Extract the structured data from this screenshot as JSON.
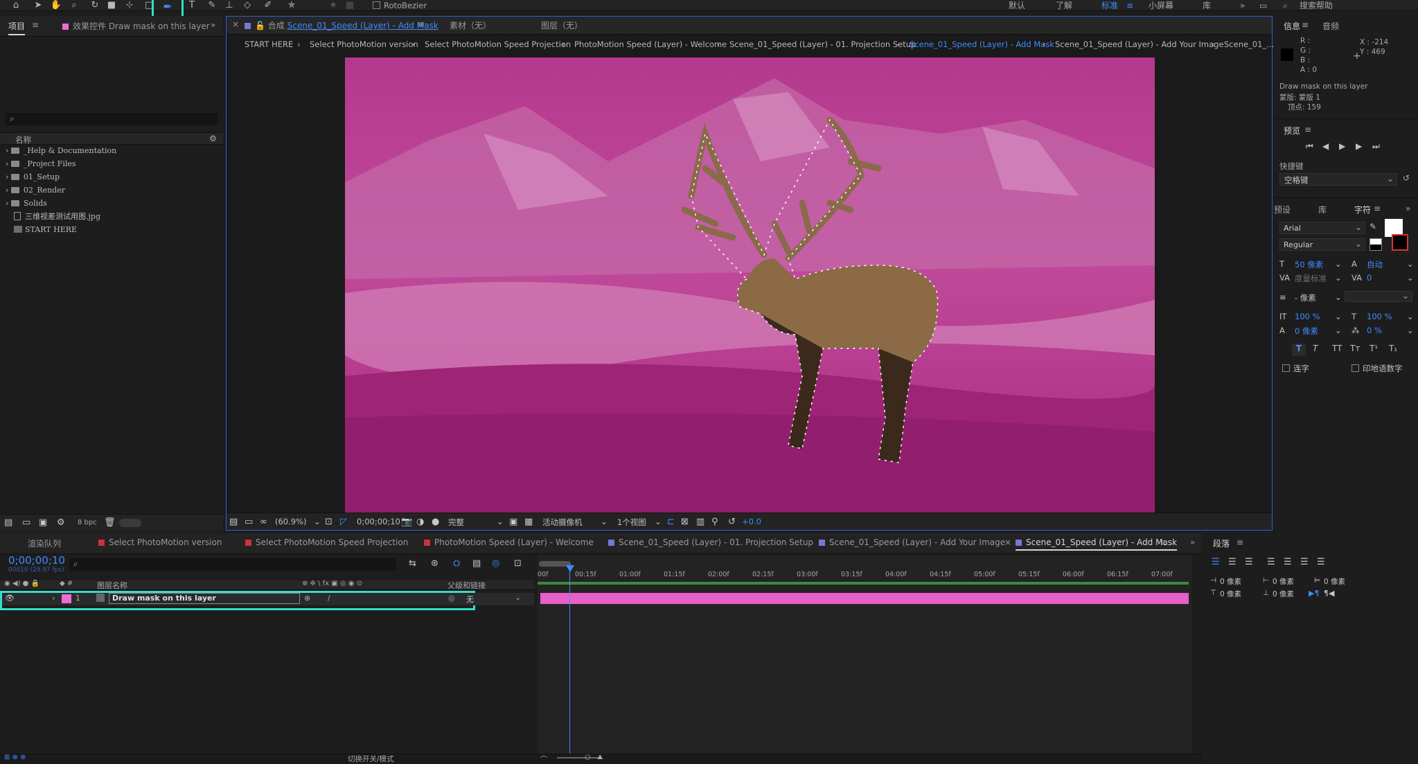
{
  "toolbar": {
    "rotobezier_label": "RotoBezier",
    "workspaces": [
      "默认",
      "了解",
      "标准",
      "小屏幕",
      "库"
    ],
    "search_placeholder": "搜索帮助"
  },
  "project_panel": {
    "tab_label": "项目",
    "effects_tab_label": "效果控件 Draw mask on this layer",
    "column_name": "名称",
    "items": [
      {
        "label": "_Help & Documentation",
        "type": "folder"
      },
      {
        "label": "_Project Files",
        "type": "folder"
      },
      {
        "label": "01_Setup",
        "type": "folder"
      },
      {
        "label": "02_Render",
        "type": "folder"
      },
      {
        "label": "Solids",
        "type": "folder"
      },
      {
        "label": "三维视差测试用图.jpg",
        "type": "file"
      },
      {
        "label": "START HERE",
        "type": "comp"
      }
    ],
    "bpc_label": "8 bpc"
  },
  "viewer": {
    "comp_tab_prefix": "合成",
    "comp_tab_name": "Scene_01_Speed (Layer) - Add Mask",
    "footage_tab": "素材（无）",
    "layer_tab": "图层（无）",
    "breadcrumbs": [
      "START HERE",
      "Select PhotoMotion version",
      "Select PhotoMotion Speed Projection",
      "PhotoMotion Speed (Layer) - Welcome",
      "Scene_01_Speed (Layer) - 01. Projection Setup",
      "Scene_01_Speed (Layer) - Add Mask",
      "Scene_01_Speed (Layer) - Add Your Image",
      "Scene_01_..."
    ],
    "active_breadcrumb": 5,
    "zoom": "(60.9%)",
    "timecode": "0;00;00;10",
    "resolution": "完整",
    "camera": "活动摄像机",
    "views": "1个视图",
    "exposure": "+0.0"
  },
  "info_panel": {
    "tab_info": "信息",
    "tab_audio": "音频",
    "r": "R :",
    "g": "G :",
    "b": "B :",
    "a": "A : 0",
    "x": "X : -214",
    "y": "Y : 469",
    "msg1": "Draw mask on this layer",
    "msg2": "蒙版: 蒙版 1",
    "msg3": "顶点: 159"
  },
  "preview_panel": {
    "title": "预览",
    "shortcut_label": "快捷键",
    "shortcut_value": "空格键"
  },
  "character_panel": {
    "tabs": [
      "预设",
      "库",
      "字符"
    ],
    "font": "Arial",
    "style": "Regular",
    "size": "50 像素",
    "leading": "自动",
    "kerning": "度量标准",
    "tracking": "0",
    "stroke": "- 像素",
    "vscale": "100 %",
    "hscale": "100 %",
    "baseline": "0 像素",
    "tsume": "0 %",
    "ligature": "连字",
    "hindi": "印地语数字",
    "fill_color": "#ffffff",
    "stroke_color": "#000000"
  },
  "timeline": {
    "render_queue": "渲染队列",
    "tabs": [
      {
        "label": "Select PhotoMotion version",
        "color": "#d0303a"
      },
      {
        "label": "Select PhotoMotion Speed Projection",
        "color": "#d0303a"
      },
      {
        "label": "PhotoMotion Speed (Layer) - Welcome",
        "color": "#d0303a"
      },
      {
        "label": "Scene_01_Speed (Layer) - 01. Projection Setup",
        "color": "#7478d8"
      },
      {
        "label": "Scene_01_Speed (Layer) - Add Your Image",
        "color": "#7478d8"
      },
      {
        "label": "Scene_01_Speed (Layer) - Add Mask",
        "color": "#7478d8"
      }
    ],
    "timecode": "0;00;00;10",
    "frame_info": "00010 (29.97 fps)",
    "layer_name_header": "图层名称",
    "parent_header": "父级和链接",
    "layer": {
      "index": "1",
      "name": "Draw mask on this layer",
      "parent": "无",
      "color": "#f06ad3"
    },
    "ruler": [
      "00f",
      "00:15f",
      "01:00f",
      "01:15f",
      "02:00f",
      "02:15f",
      "03:00f",
      "03:15f",
      "04:00f",
      "04:15f",
      "05:00f",
      "05:15f",
      "06:00f",
      "06:15f",
      "07:00f"
    ],
    "toggle_label": "切换开关/模式"
  },
  "paragraph_panel": {
    "title": "段落",
    "indent1": "0 像素",
    "indent2": "0 像素",
    "indent3": "0 像素",
    "space1": "0 像素",
    "space2": "0 像素"
  }
}
